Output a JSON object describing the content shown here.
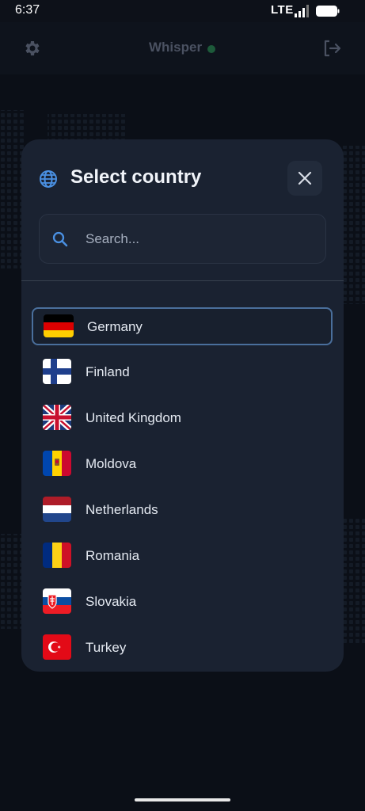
{
  "status_bar": {
    "time": "6:37",
    "network": "LTE"
  },
  "app_bar": {
    "title": "Whisper",
    "status_color": "#1d5a3a"
  },
  "modal": {
    "title": "Select country",
    "search_placeholder": "Search...",
    "countries": [
      {
        "name": "Germany",
        "flag": "germany-flag",
        "selected": true
      },
      {
        "name": "Finland",
        "flag": "finland-flag",
        "selected": false
      },
      {
        "name": "United Kingdom",
        "flag": "uk-flag",
        "selected": false
      },
      {
        "name": "Moldova",
        "flag": "moldova-flag",
        "selected": false
      },
      {
        "name": "Netherlands",
        "flag": "netherlands-flag",
        "selected": false
      },
      {
        "name": "Romania",
        "flag": "romania-flag",
        "selected": false
      },
      {
        "name": "Slovakia",
        "flag": "slovakia-flag",
        "selected": false
      },
      {
        "name": "Turkey",
        "flag": "turkey-flag",
        "selected": false
      }
    ]
  },
  "colors": {
    "background": "#0b0f17",
    "modal_bg": "#1a2231",
    "accent": "#4a90e2",
    "selected_border": "#4a6f9c"
  }
}
